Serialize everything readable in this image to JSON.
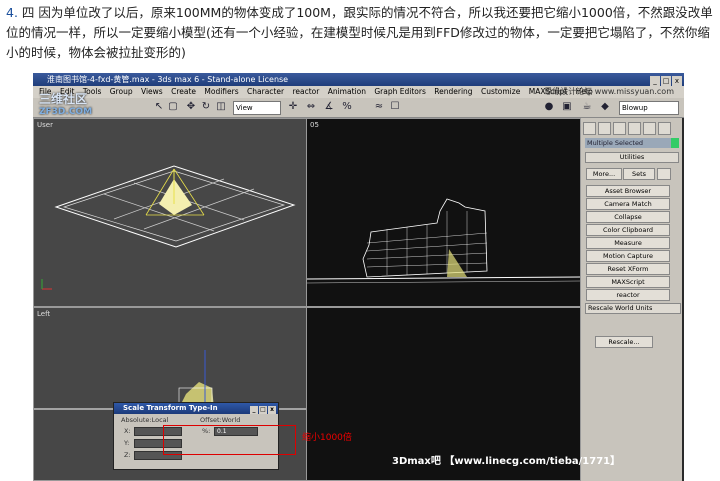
{
  "intro_number": "4.",
  "intro_text": "四 因为单位改了以后，原来100MM的物体变成了100M，跟实际的情况不符合，所以我还要把它缩小1000倍，不然跟没改单位的情况一样，所以一定要缩小模型(还有一个小经验，在建模型时候凡是用到FFD修改过的物体，一定要把它塌陷了，不然你缩小的时候，物体会被拉扯变形的)",
  "window_title": "淮南图书馆-4-fxd-黄管.max - 3ds max 6 - Stand-alone License",
  "window_buttons": [
    "_",
    "□",
    "x"
  ],
  "menu": [
    "File",
    "Edit",
    "Tools",
    "Group",
    "Views",
    "Create",
    "Modifiers",
    "Character",
    "reactor",
    "Animation",
    "Graph Editors",
    "Rendering",
    "Customize",
    "MAXScript",
    "Help"
  ],
  "brand_watermark": "思缘设计论坛 www.missyuan.com",
  "logo_line1": "三维社区",
  "logo_line2": "ZF3D.COM",
  "view_select": "View",
  "blowup_select": "Blowup",
  "viewports": {
    "top_left": "User",
    "top_right": "05",
    "bottom_left": "Left"
  },
  "command_panel": {
    "selection": "Multiple Selected",
    "rollout_title": "Utilities",
    "more_label": "More...",
    "sets_label": "Sets",
    "buttons": [
      "Asset Browser",
      "Camera Match",
      "Collapse",
      "Color Clipboard",
      "Measure",
      "Motion Capture",
      "Reset XForm",
      "MAXScript",
      "reactor"
    ],
    "rescale_title": "Rescale World Units",
    "rescale_button": "Rescale..."
  },
  "dialog": {
    "title": "Scale Transform Type-In",
    "left_group": "Absolute:Local",
    "right_group": "Offset:World",
    "axis_labels": [
      "X:",
      "Y:",
      "Z:"
    ],
    "offset_axis": "%:",
    "offset_value": "0.1"
  },
  "annotation": "缩小1000倍",
  "credit": "3Dmax吧 【www.linecg.com/tieba/1771】"
}
